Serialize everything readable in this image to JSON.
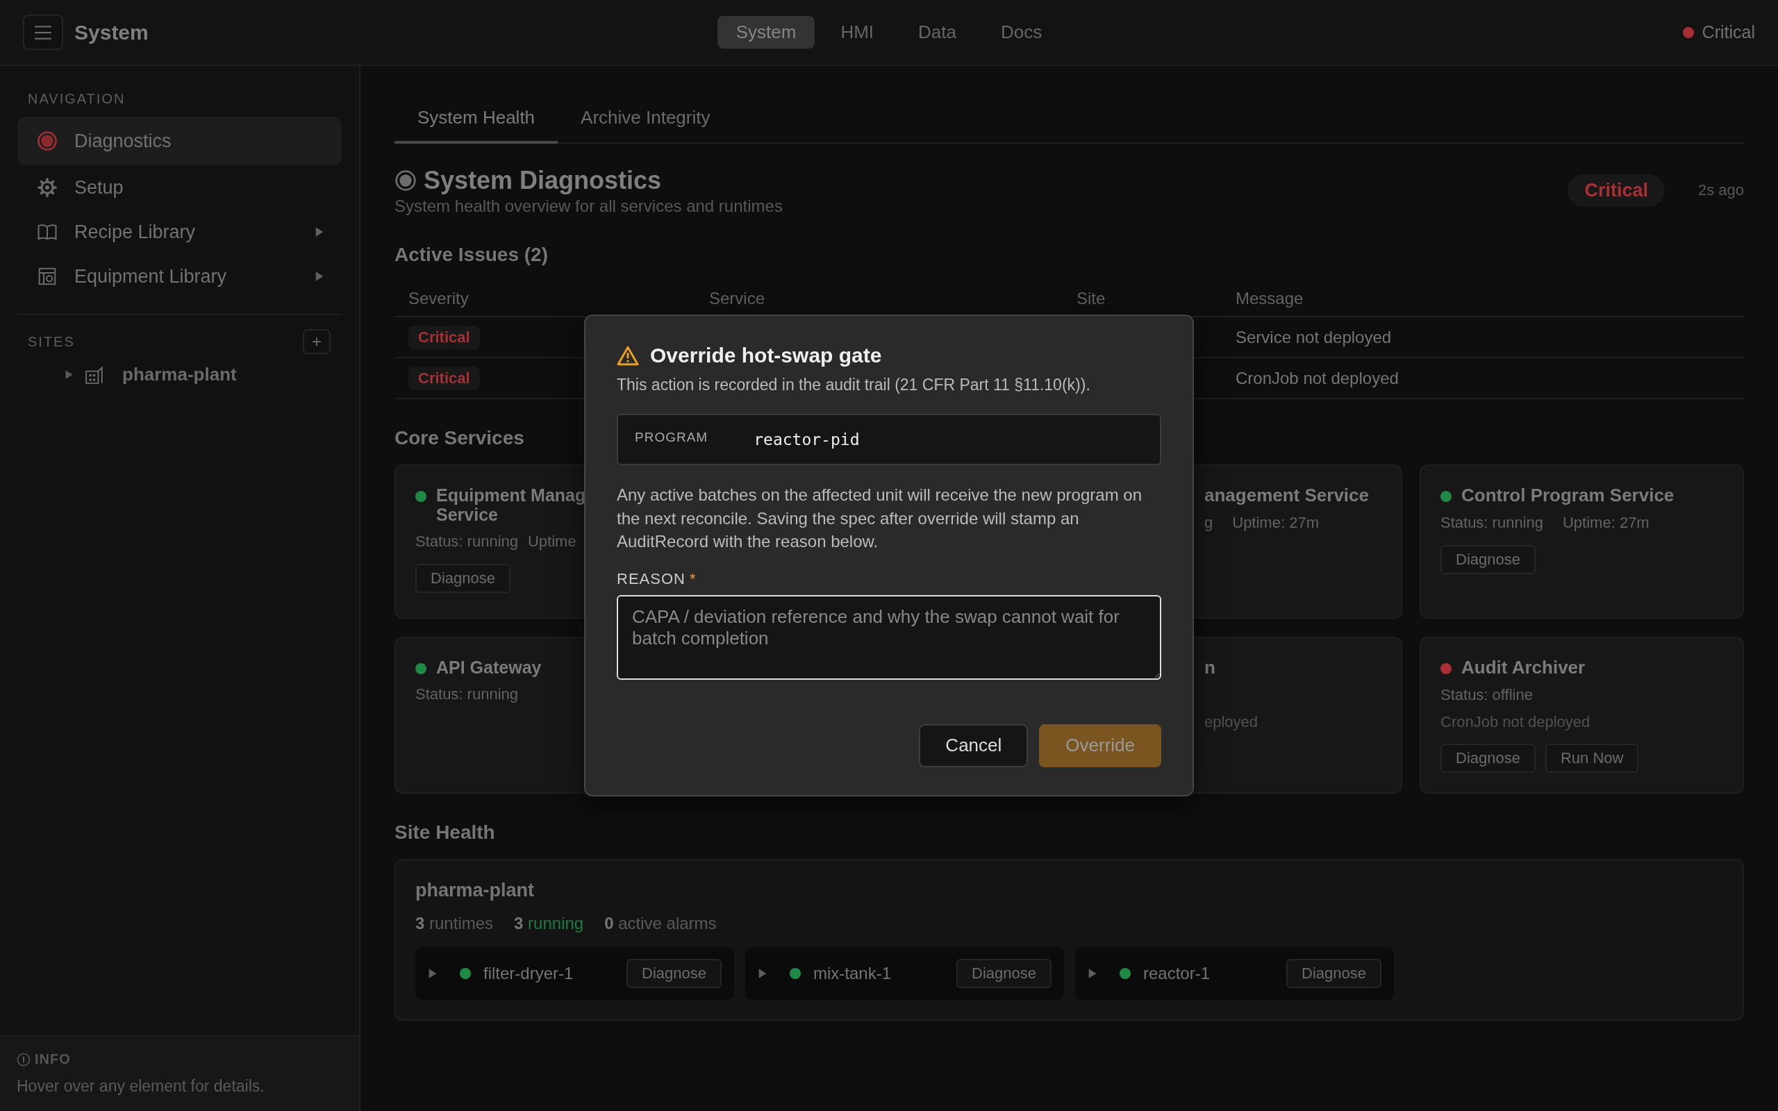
{
  "topbar": {
    "title": "System",
    "tabs": [
      {
        "label": "System",
        "selected": true
      },
      {
        "label": "HMI",
        "selected": false
      },
      {
        "label": "Data",
        "selected": false
      },
      {
        "label": "Docs",
        "selected": false
      }
    ],
    "status": {
      "label": "Critical",
      "color": "#a83034"
    }
  },
  "sidebar": {
    "nav_heading": "NAVIGATION",
    "items": [
      {
        "label": "Diagnostics",
        "kind": "diagnostics",
        "selected": true,
        "expandable": false
      },
      {
        "label": "Setup",
        "kind": "setup",
        "selected": false,
        "expandable": false
      },
      {
        "label": "Recipe Library",
        "kind": "library",
        "selected": false,
        "expandable": true
      },
      {
        "label": "Equipment Library",
        "kind": "equipment",
        "selected": false,
        "expandable": true
      }
    ],
    "sites_heading": "SITES",
    "add_button": "+",
    "sites": [
      {
        "label": "pharma-plant",
        "expanded": false
      }
    ],
    "info": {
      "heading": "INFO",
      "text": "Hover over any element for details."
    }
  },
  "main": {
    "tabs": [
      {
        "label": "System Health",
        "selected": true
      },
      {
        "label": "Archive Integrity",
        "selected": false
      }
    ],
    "header": {
      "title": "System Diagnostics",
      "subtitle": "System health overview for all services and runtimes",
      "badge": "Critical",
      "updated": "2s ago"
    },
    "issues": {
      "title": "Active Issues (2)",
      "columns": [
        "Severity",
        "Service",
        "Site",
        "Message"
      ],
      "rows": [
        {
          "severity": "Critical",
          "message": "Service not deployed"
        },
        {
          "severity": "Critical",
          "message": "CronJob not deployed"
        }
      ]
    },
    "core_services": {
      "title": "Core Services",
      "cards": [
        {
          "color": "#1f8a45",
          "name": "Equipment Manag\nService",
          "status": "Status: running",
          "uptime": "Uptime",
          "buttons": [
            "Diagnose"
          ]
        },
        {
          "name": "anagement Service",
          "status": "g",
          "uptime": "Uptime: 27m"
        },
        {
          "color": "#1f8a45",
          "name": "Control Program Service",
          "status": "Status: running",
          "uptime": "Uptime: 27m",
          "buttons": [
            "Diagnose"
          ]
        },
        {
          "color": "#1f8a45",
          "name": "API Gateway",
          "status": "Status: running"
        },
        {
          "name": "n",
          "message": "eployed"
        },
        {
          "color": "#a83034",
          "name": "Audit Archiver",
          "status": "Status: offline",
          "message": "CronJob not deployed",
          "buttons": [
            "Diagnose",
            "Run Now"
          ]
        }
      ]
    },
    "site_health": {
      "title": "Site Health",
      "site": "pharma-plant",
      "stats": [
        {
          "count": "3",
          "label": "runtimes",
          "kind": "plain"
        },
        {
          "count": "3",
          "label": "running",
          "kind": "good"
        },
        {
          "count": "0",
          "label": "active alarms",
          "kind": "plain"
        }
      ],
      "runtimes": [
        {
          "name": "filter-dryer-1",
          "color": "#1f8a45",
          "button": "Diagnose"
        },
        {
          "name": "mix-tank-1",
          "color": "#1f8a45",
          "button": "Diagnose"
        },
        {
          "name": "reactor-1",
          "color": "#1f8a45",
          "button": "Diagnose"
        }
      ]
    }
  },
  "modal": {
    "title": "Override hot-swap gate",
    "subtitle": "This action is recorded in the audit trail (21 CFR Part 11 §11.10(k)).",
    "program_label": "PROGRAM",
    "program_value": "reactor-pid",
    "body": "Any active batches on the affected unit will receive the new program on the next reconcile. Saving the spec after override will stamp an AuditRecord with the reason below.",
    "reason_label": "REASON",
    "required_mark": "*",
    "reason_placeholder": "CAPA / deviation reference and why the swap cannot wait for batch completion",
    "cancel": "Cancel",
    "confirm": {
      "label": "Override",
      "disabled": true
    }
  }
}
